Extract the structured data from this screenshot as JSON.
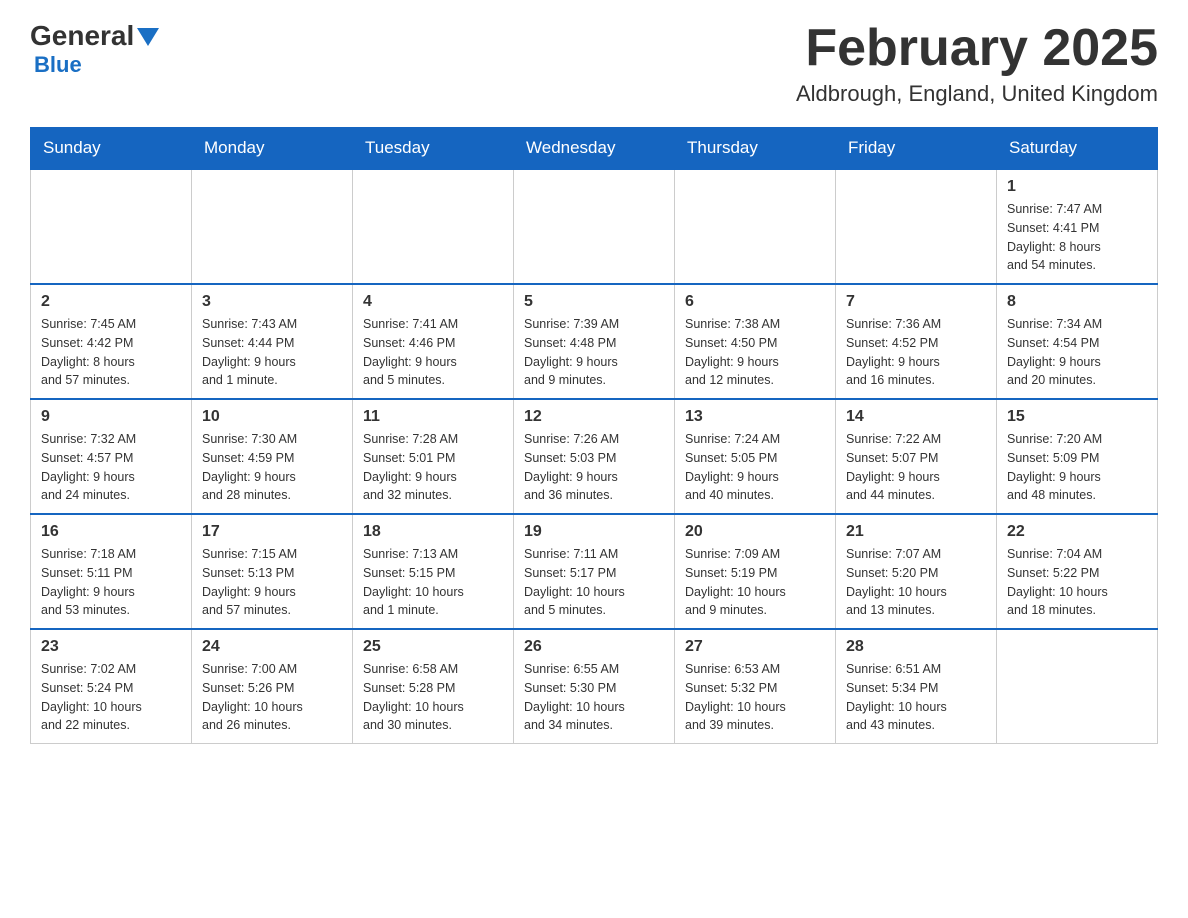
{
  "header": {
    "logo_general": "General",
    "logo_blue": "Blue",
    "month_title": "February 2025",
    "location": "Aldbrough, England, United Kingdom"
  },
  "days_of_week": [
    "Sunday",
    "Monday",
    "Tuesday",
    "Wednesday",
    "Thursday",
    "Friday",
    "Saturday"
  ],
  "weeks": [
    {
      "days": [
        {
          "number": "",
          "info": "",
          "empty": true
        },
        {
          "number": "",
          "info": "",
          "empty": true
        },
        {
          "number": "",
          "info": "",
          "empty": true
        },
        {
          "number": "",
          "info": "",
          "empty": true
        },
        {
          "number": "",
          "info": "",
          "empty": true
        },
        {
          "number": "",
          "info": "",
          "empty": true
        },
        {
          "number": "1",
          "info": "Sunrise: 7:47 AM\nSunset: 4:41 PM\nDaylight: 8 hours\nand 54 minutes.",
          "empty": false
        }
      ]
    },
    {
      "days": [
        {
          "number": "2",
          "info": "Sunrise: 7:45 AM\nSunset: 4:42 PM\nDaylight: 8 hours\nand 57 minutes.",
          "empty": false
        },
        {
          "number": "3",
          "info": "Sunrise: 7:43 AM\nSunset: 4:44 PM\nDaylight: 9 hours\nand 1 minute.",
          "empty": false
        },
        {
          "number": "4",
          "info": "Sunrise: 7:41 AM\nSunset: 4:46 PM\nDaylight: 9 hours\nand 5 minutes.",
          "empty": false
        },
        {
          "number": "5",
          "info": "Sunrise: 7:39 AM\nSunset: 4:48 PM\nDaylight: 9 hours\nand 9 minutes.",
          "empty": false
        },
        {
          "number": "6",
          "info": "Sunrise: 7:38 AM\nSunset: 4:50 PM\nDaylight: 9 hours\nand 12 minutes.",
          "empty": false
        },
        {
          "number": "7",
          "info": "Sunrise: 7:36 AM\nSunset: 4:52 PM\nDaylight: 9 hours\nand 16 minutes.",
          "empty": false
        },
        {
          "number": "8",
          "info": "Sunrise: 7:34 AM\nSunset: 4:54 PM\nDaylight: 9 hours\nand 20 minutes.",
          "empty": false
        }
      ]
    },
    {
      "days": [
        {
          "number": "9",
          "info": "Sunrise: 7:32 AM\nSunset: 4:57 PM\nDaylight: 9 hours\nand 24 minutes.",
          "empty": false
        },
        {
          "number": "10",
          "info": "Sunrise: 7:30 AM\nSunset: 4:59 PM\nDaylight: 9 hours\nand 28 minutes.",
          "empty": false
        },
        {
          "number": "11",
          "info": "Sunrise: 7:28 AM\nSunset: 5:01 PM\nDaylight: 9 hours\nand 32 minutes.",
          "empty": false
        },
        {
          "number": "12",
          "info": "Sunrise: 7:26 AM\nSunset: 5:03 PM\nDaylight: 9 hours\nand 36 minutes.",
          "empty": false
        },
        {
          "number": "13",
          "info": "Sunrise: 7:24 AM\nSunset: 5:05 PM\nDaylight: 9 hours\nand 40 minutes.",
          "empty": false
        },
        {
          "number": "14",
          "info": "Sunrise: 7:22 AM\nSunset: 5:07 PM\nDaylight: 9 hours\nand 44 minutes.",
          "empty": false
        },
        {
          "number": "15",
          "info": "Sunrise: 7:20 AM\nSunset: 5:09 PM\nDaylight: 9 hours\nand 48 minutes.",
          "empty": false
        }
      ]
    },
    {
      "days": [
        {
          "number": "16",
          "info": "Sunrise: 7:18 AM\nSunset: 5:11 PM\nDaylight: 9 hours\nand 53 minutes.",
          "empty": false
        },
        {
          "number": "17",
          "info": "Sunrise: 7:15 AM\nSunset: 5:13 PM\nDaylight: 9 hours\nand 57 minutes.",
          "empty": false
        },
        {
          "number": "18",
          "info": "Sunrise: 7:13 AM\nSunset: 5:15 PM\nDaylight: 10 hours\nand 1 minute.",
          "empty": false
        },
        {
          "number": "19",
          "info": "Sunrise: 7:11 AM\nSunset: 5:17 PM\nDaylight: 10 hours\nand 5 minutes.",
          "empty": false
        },
        {
          "number": "20",
          "info": "Sunrise: 7:09 AM\nSunset: 5:19 PM\nDaylight: 10 hours\nand 9 minutes.",
          "empty": false
        },
        {
          "number": "21",
          "info": "Sunrise: 7:07 AM\nSunset: 5:20 PM\nDaylight: 10 hours\nand 13 minutes.",
          "empty": false
        },
        {
          "number": "22",
          "info": "Sunrise: 7:04 AM\nSunset: 5:22 PM\nDaylight: 10 hours\nand 18 minutes.",
          "empty": false
        }
      ]
    },
    {
      "days": [
        {
          "number": "23",
          "info": "Sunrise: 7:02 AM\nSunset: 5:24 PM\nDaylight: 10 hours\nand 22 minutes.",
          "empty": false
        },
        {
          "number": "24",
          "info": "Sunrise: 7:00 AM\nSunset: 5:26 PM\nDaylight: 10 hours\nand 26 minutes.",
          "empty": false
        },
        {
          "number": "25",
          "info": "Sunrise: 6:58 AM\nSunset: 5:28 PM\nDaylight: 10 hours\nand 30 minutes.",
          "empty": false
        },
        {
          "number": "26",
          "info": "Sunrise: 6:55 AM\nSunset: 5:30 PM\nDaylight: 10 hours\nand 34 minutes.",
          "empty": false
        },
        {
          "number": "27",
          "info": "Sunrise: 6:53 AM\nSunset: 5:32 PM\nDaylight: 10 hours\nand 39 minutes.",
          "empty": false
        },
        {
          "number": "28",
          "info": "Sunrise: 6:51 AM\nSunset: 5:34 PM\nDaylight: 10 hours\nand 43 minutes.",
          "empty": false
        },
        {
          "number": "",
          "info": "",
          "empty": true
        }
      ]
    }
  ]
}
